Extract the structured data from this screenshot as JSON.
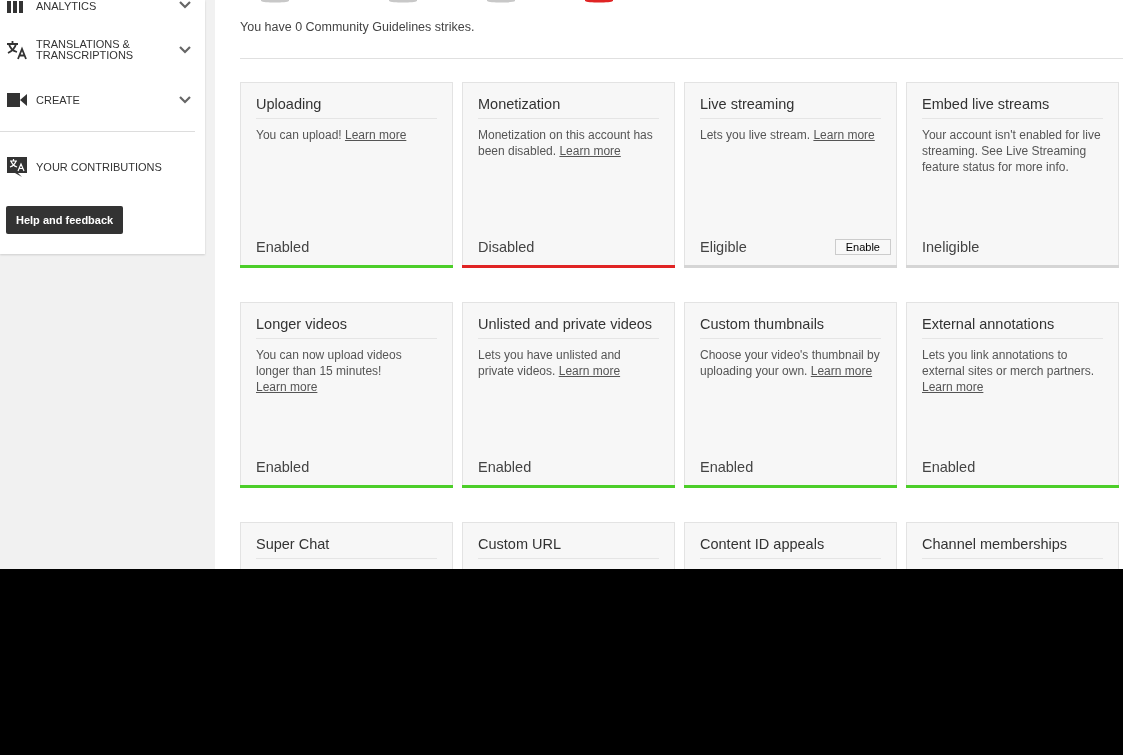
{
  "sidebar": {
    "items": [
      {
        "label": "ANALYTICS",
        "kind": "bars",
        "expandable": true
      },
      {
        "label": "TRANSLATIONS & TRANSCRIPTIONS",
        "kind": "translate",
        "expandable": true
      },
      {
        "label": "CREATE",
        "kind": "camera",
        "expandable": true
      },
      {
        "label": "YOUR CONTRIBUTIONS",
        "kind": "contrib",
        "expandable": false
      }
    ],
    "help_button": "Help and feedback"
  },
  "strike_icons": [
    {
      "active": false
    },
    {
      "active": false
    },
    {
      "active": false
    },
    {
      "active": true
    }
  ],
  "strikes_text": "You have 0 Community Guidelines strikes.",
  "features": [
    {
      "title": "Uploading",
      "description": "You can upload!",
      "link": "Learn more",
      "status": "Enabled",
      "color": "#4cce29"
    },
    {
      "title": "Monetization",
      "description": "Monetization on this account has been disabled.",
      "link": "Learn more",
      "status": "Disabled",
      "color": "#e02424"
    },
    {
      "title": "Live streaming",
      "description": "Lets you live stream.",
      "link": "Learn more",
      "status": "Eligible",
      "color": "#d5d5d5",
      "action": "Enable"
    },
    {
      "title": "Embed live streams",
      "description": "Your account isn't enabled for live streaming. See Live Streaming feature status for more info.",
      "status": "Ineligible",
      "color": "#d5d5d5"
    },
    {
      "title": "Longer videos",
      "description": "You can now upload videos longer than 15 minutes!",
      "link": "Learn more",
      "status": "Enabled",
      "color": "#4cce29"
    },
    {
      "title": "Unlisted and private videos",
      "description": "Lets you have unlisted and private videos.",
      "link": "Learn more",
      "status": "Enabled",
      "color": "#4cce29"
    },
    {
      "title": "Custom thumbnails",
      "description": "Choose your video's thumbnail by uploading your own.",
      "link": "Learn more",
      "status": "Enabled",
      "color": "#4cce29"
    },
    {
      "title": "External annotations",
      "description": "Lets you link annotations to external sites or merch partners.",
      "link": "Learn more",
      "status": "Enabled",
      "color": "#4cce29"
    },
    {
      "title": "Super Chat"
    },
    {
      "title": "Custom URL"
    },
    {
      "title": "Content ID appeals"
    },
    {
      "title": "Channel memberships"
    }
  ]
}
